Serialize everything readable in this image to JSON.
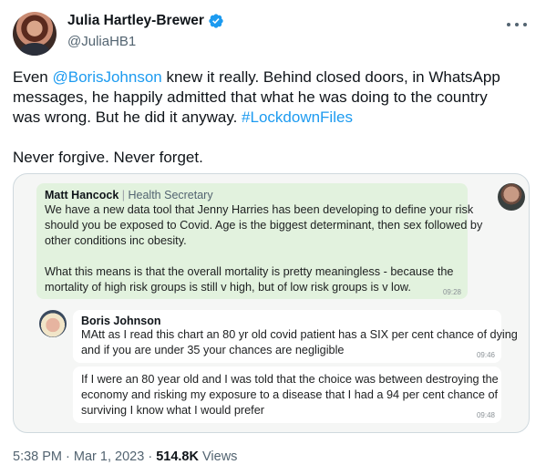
{
  "author": {
    "display_name": "Julia Hartley-Brewer",
    "handle": "@JuliaHB1",
    "avatar_icon": "user-avatar-photo",
    "verified_icon": "verified-badge-icon",
    "verified_color": "#1d9bf0"
  },
  "tweet": {
    "line1_pre": "Even ",
    "mention": "@BorisJohnson",
    "line1_post": " knew it really. Behind closed doors, in WhatsApp",
    "line2": "messages, he happily admitted that what he was doing to the country",
    "line3_pre": "was wrong. But he did it anyway. ",
    "hashtag": "#LockdownFiles",
    "line4": "Never forgive. Never forget.",
    "link_color": "#1d9bf0"
  },
  "media": {
    "message1": {
      "sender": "Matt Hancock",
      "separator": "|",
      "role": "Health Secretary",
      "lines": [
        "We have a new data tool that Jenny Harries has been developing to define your risk",
        "should you be exposed to Covid. Age is the biggest determinant, then sex followed by",
        "other conditions inc obesity."
      ],
      "lines2": [
        "What this means is that the overall mortality is pretty meaningless - because the",
        "mortality of high risk groups is still v high, but of low risk groups is v low."
      ],
      "time": "09:28",
      "bubble_color": "#e2f2de"
    },
    "message2": {
      "sender": "Boris Johnson",
      "lines": [
        "MAtt as I read this chart an 80 yr old covid patient has a SIX per cent chance of dying",
        "and if you are under 35 your chances are negligible"
      ],
      "time": "09:46"
    },
    "message3": {
      "lines": [
        "If I were an 80 year old and I was told that the choice was between destroying the",
        "economy and risking my exposure to a disease that I had a 94 per cent chance of",
        "surviving I know what I would prefer"
      ],
      "time": "09:48"
    }
  },
  "footer": {
    "time": "5:38 PM",
    "dot": "·",
    "date": "Mar 1, 2023",
    "views_count": "514.8K",
    "views_label": " Views"
  }
}
